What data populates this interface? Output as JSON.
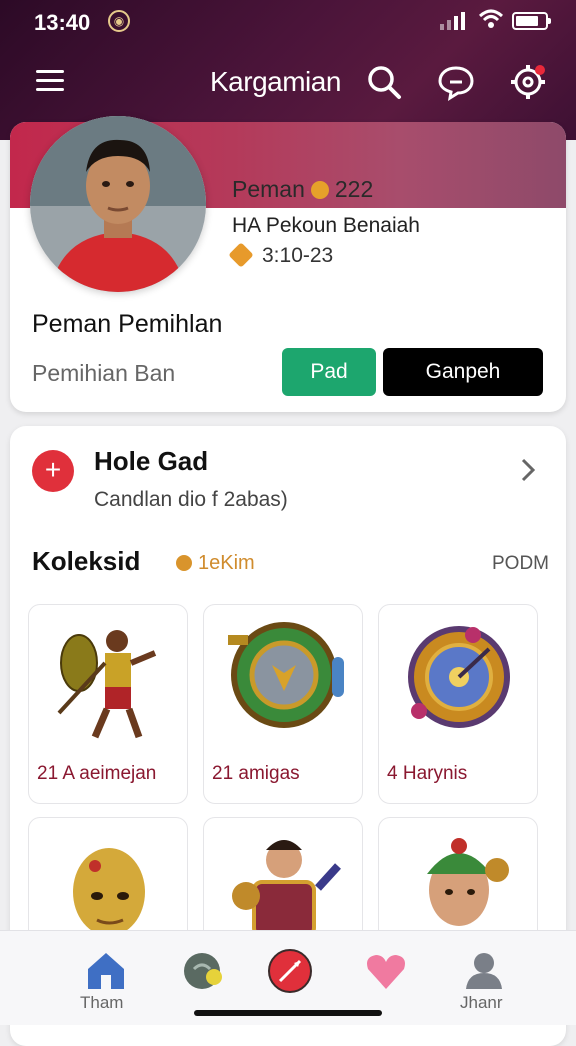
{
  "status_bar": {
    "time": "13:40"
  },
  "app_bar": {
    "title": "Kargamian"
  },
  "profile": {
    "name_line": "Peman",
    "coins": "222",
    "rank": "HA Pekoun Benaiah",
    "date": "3:10-23",
    "title": "Peman Pemihlan",
    "subtitle": "Pemihian Ban",
    "add_label": "Pad",
    "join_label": "Ganpeh"
  },
  "hole": {
    "title": "Hole Gad",
    "subtitle": "Candlan dio f 2abas)"
  },
  "collection": {
    "title": "Koleksid",
    "count": "1eKim",
    "right_label": "PODM",
    "items": [
      {
        "caption": "21 A aeimejan"
      },
      {
        "caption": "21 amigas"
      },
      {
        "caption": "4 Harynis"
      },
      {
        "caption": ""
      },
      {
        "caption": ""
      },
      {
        "caption": ""
      }
    ]
  },
  "tabs": [
    {
      "label": "Tham",
      "icon": "home-icon"
    },
    {
      "label": "",
      "icon": "chat-icon"
    },
    {
      "label": "",
      "icon": "compass-icon"
    },
    {
      "label": "",
      "icon": "heart-icon"
    },
    {
      "label": "Jhanr",
      "icon": "profile-icon"
    }
  ],
  "colors": {
    "accent_green": "#1da66e",
    "accent_red": "#e0303b",
    "header_purple": "#4a1439"
  }
}
